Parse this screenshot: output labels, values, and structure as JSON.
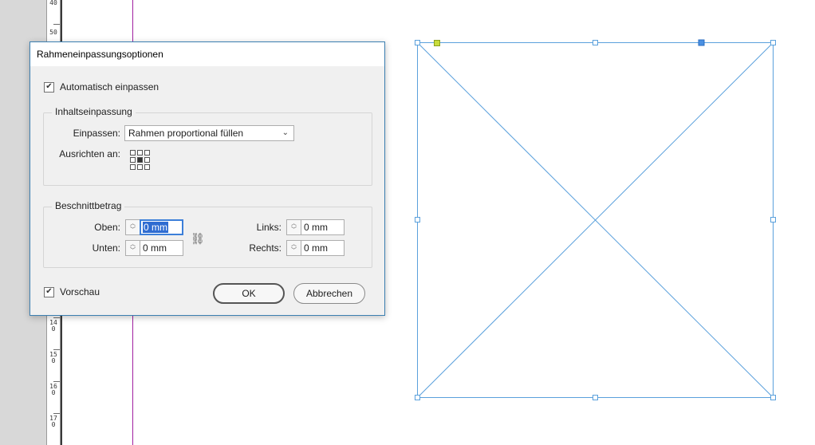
{
  "dialog": {
    "title": "Rahmeneinpassungsoptionen",
    "auto_fit": {
      "label": "Automatisch einpassen",
      "checked": true
    },
    "content_fitting": {
      "group_label": "Inhaltseinpassung",
      "fit_label": "Einpassen:",
      "fit_value": "Rahmen proportional füllen",
      "align_label": "Ausrichten an:",
      "align_selected": "center"
    },
    "crop": {
      "group_label": "Beschnittbetrag",
      "top_label": "Oben:",
      "top_value": "0 mm",
      "bottom_label": "Unten:",
      "bottom_value": "0 mm",
      "left_label": "Links:",
      "left_value": "0 mm",
      "right_label": "Rechts:",
      "right_value": "0 mm",
      "link_icon": "chain-broken-icon"
    },
    "preview": {
      "label": "Vorschau",
      "checked": true
    },
    "ok_label": "OK",
    "cancel_label": "Abbrechen"
  },
  "ruler": {
    "numbers": [
      "40",
      "50",
      "140",
      "150",
      "160",
      "170"
    ]
  },
  "colors": {
    "frame": "#5aa0dc",
    "guide": "#a020a0",
    "reference_point": "#c8dc3c",
    "selection_handle": "#4a90e2",
    "dialog_border": "#3c7fb1"
  }
}
